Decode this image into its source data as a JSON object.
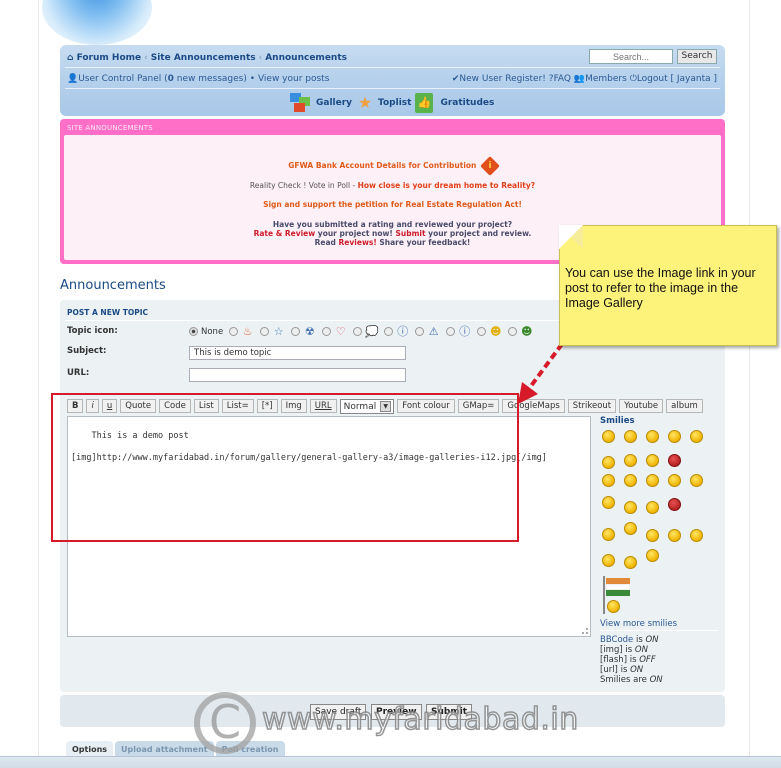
{
  "header": {
    "breadcrumb": [
      "Forum Home",
      "Site Announcements",
      "Announcements"
    ],
    "search_placeholder": "Search...",
    "search_button": "Search",
    "ucp_prefix": "User Control Panel (",
    "new_messages_count": "0",
    "ucp_suffix": " new messages)",
    "bullet": "•",
    "view_posts": "View your posts",
    "register": "New User Register!",
    "faq": "FAQ",
    "members": "Members",
    "logout": "Logout [ Jayanta ]",
    "nav_links": [
      "Gallery",
      "Toplist",
      "Gratitudes"
    ]
  },
  "announcements_box": {
    "title": "SITE ANNOUNCEMENTS",
    "line1": "GFWA Bank Account Details for Contribution",
    "line2_prefix": "Reality Check ! Vote in Poll - ",
    "line2_link": "How close is your dream home to Reality?",
    "line3": "Sign and support the petition for Real Estate Regulation Act!",
    "line4": "Have you submitted a rating and reviewed your project?",
    "line5_link1": "Rate & Review",
    "line5_mid": " your project now! ",
    "line5_link2": "Submit",
    "line5_end": " your project and review.",
    "line6_prefix": "Read ",
    "line6_link": "Reviews!",
    "line6_end": " Share your feedback!"
  },
  "page_title": "Announcements",
  "post_form": {
    "section_title": "POST A NEW TOPIC",
    "topic_icon_label": "Topic icon:",
    "topic_icon_none": "None",
    "topic_icons": [
      "fire-icon",
      "star-icon",
      "radioactive-icon",
      "heart-icon",
      "speech-bubble-icon",
      "question-icon",
      "warning-icon",
      "info-icon",
      "smiley-wink-icon",
      "smiley-grin-icon"
    ],
    "subject_label": "Subject:",
    "subject_value": "This is demo topic",
    "url_label": "URL:",
    "url_value": "",
    "toolbar": [
      "B",
      "i",
      "u",
      "Quote",
      "Code",
      "List",
      "List=",
      "[*]",
      "Img",
      "URL"
    ],
    "font_size_selected": "Normal",
    "toolbar2": [
      "Font colour",
      "GMap=",
      "GoogleMaps",
      "Strikeout",
      "Youtube",
      "album"
    ],
    "message": "This is a demo post\n\n[img]http://www.myfaridabad.in/forum/gallery/general-gallery-a3/image-galleries-i12.jpg[/img]"
  },
  "smilies": {
    "title": "Smilies",
    "view_more": "View more smilies",
    "status": [
      {
        "key": "BBCode",
        "mid": " is ",
        "val": "ON"
      },
      {
        "key": "[img]",
        "mid": " is ",
        "val": "ON"
      },
      {
        "key": "[flash]",
        "mid": " is ",
        "val": "OFF"
      },
      {
        "key": "[url]",
        "mid": " is ",
        "val": "ON"
      },
      {
        "key": "Smilies",
        "mid": " are ",
        "val": "ON"
      }
    ]
  },
  "buttons": {
    "save_draft": "Save draft",
    "preview": "Preview",
    "submit": "Submit"
  },
  "tabs": [
    "Options",
    "Upload attachment",
    "Poll creation"
  ],
  "callout": {
    "text": "You can use the Image link in your post to refer to the image in the Image Gallery"
  },
  "watermark": {
    "symbol": "C",
    "text": "www.myfaridabad.in"
  },
  "colors": {
    "nav_blue": "#1a4a85",
    "announce_pink": "#ff6ec7",
    "highlight_red": "#d61a2a",
    "note_yellow": "#fdf27a"
  }
}
